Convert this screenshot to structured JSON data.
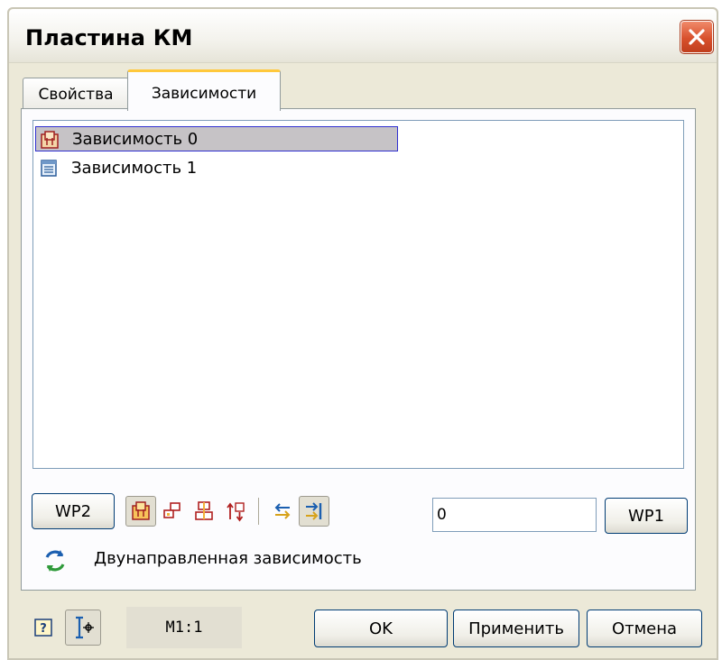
{
  "window": {
    "title": "Пластина КМ"
  },
  "tabs": [
    {
      "label": "Свойства",
      "active": false
    },
    {
      "label": "Зависимости",
      "active": true
    }
  ],
  "dependencies": [
    {
      "label": "Зависимость 0",
      "icon": "rigid-dependency-icon",
      "selected": true
    },
    {
      "label": "Зависимость 1",
      "icon": "table-dependency-icon",
      "selected": false
    }
  ],
  "toolbar": {
    "wp2_label": "WP2",
    "wp1_label": "WP1",
    "offset_value": "0",
    "dependency_type_label": "Двунаправленная зависимость"
  },
  "footer": {
    "scale_label": "M1:1",
    "ok_label": "OK",
    "apply_label": "Применить",
    "cancel_label": "Отмена"
  },
  "colors": {
    "selection_border": "#3030d0",
    "selection_fill": "#c6c3c6",
    "active_tab_highlight": "#ffc83c",
    "close_button": "#d8502c"
  }
}
